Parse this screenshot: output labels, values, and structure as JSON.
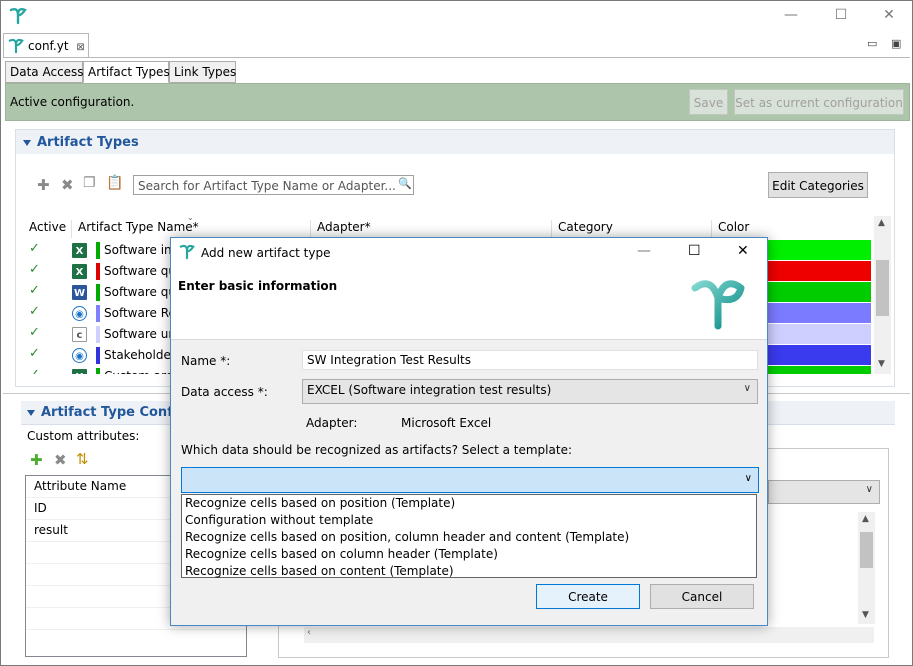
{
  "editor_tab": {
    "label": "conf.yt"
  },
  "config_tabs": [
    "Data Access",
    "Artifact Types",
    "Link Types"
  ],
  "status": {
    "text": "Active configuration.",
    "save_label": "Save",
    "set_current_label": "Set as current configuration"
  },
  "artifact_types": {
    "section_title": "Artifact Types",
    "search_placeholder": "Search for Artifact Type Name or Adapter...",
    "edit_categories_label": "Edit Categories",
    "columns": [
      "Active",
      "Artifact Type Name*",
      "Adapter*",
      "Category",
      "Color"
    ],
    "rows": [
      {
        "active": "✓",
        "icon": "excel-icon",
        "bar_color": "#00aa00",
        "name": "Software int",
        "color": "#00ee00"
      },
      {
        "active": "✓",
        "icon": "excel-icon",
        "bar_color": "#dd0000",
        "name": "Software qu",
        "color": "#ee0000"
      },
      {
        "active": "✓",
        "icon": "word-icon",
        "bar_color": "#00aa00",
        "name": "Software qu",
        "color": "#00cc00"
      },
      {
        "active": "✓",
        "icon": "codebeamer-icon",
        "bar_color": "#8080ff",
        "name": "Software Re",
        "color": "#7b7bff"
      },
      {
        "active": "✓",
        "icon": "source-icon",
        "bar_color": "#d0d0ff",
        "name": "Software un",
        "color": "#cfcfff"
      },
      {
        "active": "✓",
        "icon": "codebeamer-icon",
        "bar_color": "#3333dd",
        "name": "Stakeholder",
        "color": "#3a3aee"
      },
      {
        "active": "✓",
        "icon": "excel-icon",
        "bar_color": "#00aa00",
        "name": "Custom arch",
        "color": "#00cc00"
      }
    ]
  },
  "config_section": {
    "title": "Artifact Type Configu",
    "custom_attributes_label": "Custom attributes:",
    "attr_header": "Attribute Name",
    "attributes": [
      "ID",
      "result"
    ]
  },
  "dialog": {
    "title": "Add new artifact type",
    "header": "Enter basic information",
    "name_label": "Name *:",
    "name_value": "SW Integration Test Results",
    "data_access_label": "Data access *:",
    "data_access_value": "EXCEL (Software integration test results)",
    "adapter_label": "Adapter:",
    "adapter_value": "Microsoft Excel",
    "template_question": "Which data should be recognized as artifacts? Select a template:",
    "template_value": "",
    "template_options": [
      "Recognize cells based on position (Template)",
      "Configuration without template",
      "Recognize cells based on position, column header and content (Template)",
      "Recognize cells based on column header (Template)",
      "Recognize cells based on content (Template)"
    ],
    "create_label": "Create",
    "cancel_label": "Cancel"
  }
}
